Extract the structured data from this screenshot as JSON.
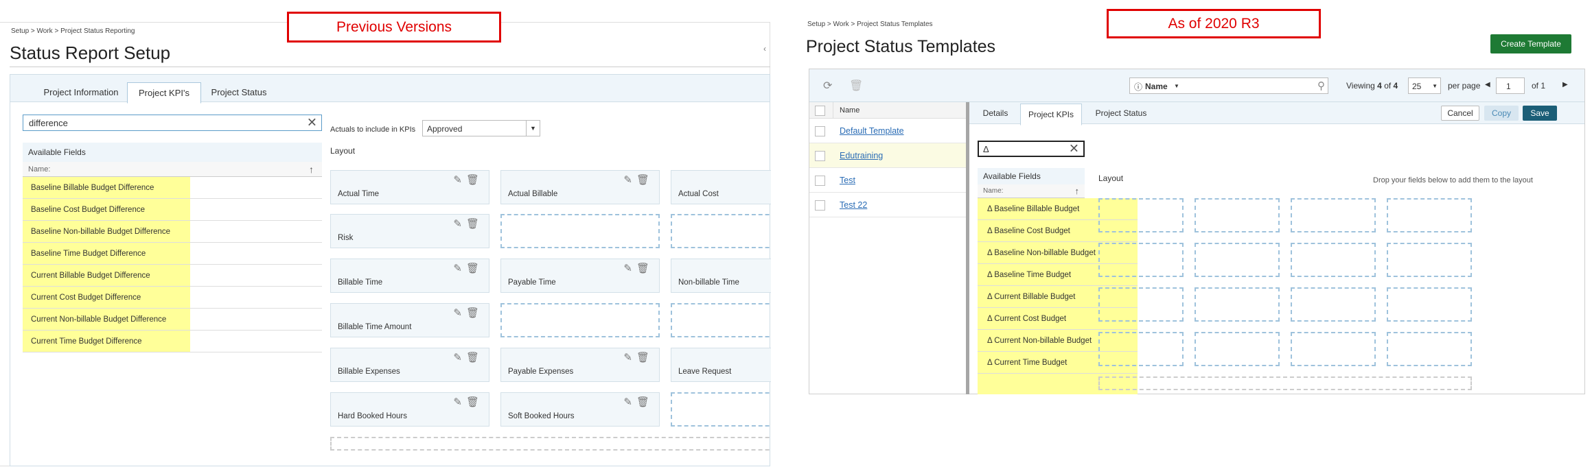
{
  "labels": {
    "previous": "Previous Versions",
    "current": "As of 2020 R3"
  },
  "left": {
    "breadcrumb": "Setup > Work > Project Status Reporting",
    "title": "Status Report Setup",
    "tabs": [
      "Project Information",
      "Project KPI's",
      "Project Status"
    ],
    "search_value": "difference",
    "available_fields_label": "Available Fields",
    "name_label": "Name:",
    "fields": [
      "Baseline Billable Budget Difference",
      "Baseline Cost Budget Difference",
      "Baseline Non-billable Budget Difference",
      "Baseline Time Budget Difference",
      "Current Billable Budget Difference",
      "Current Cost Budget Difference",
      "Current Non-billable Budget Difference",
      "Current Time Budget Difference"
    ],
    "actuals_label": "Actuals to include in KPIs",
    "actuals_value": "Approved",
    "layout_label": "Layout",
    "kpis": {
      "actual_time": "Actual Time",
      "actual_billable": "Actual Billable",
      "actual_cost": "Actual Cost",
      "risk": "Risk",
      "billable_time": "Billable Time",
      "payable_time": "Payable Time",
      "non_billable_time": "Non-billable Time",
      "billable_time_amount": "Billable Time Amount",
      "billable_expenses": "Billable Expenses",
      "payable_expenses": "Payable Expenses",
      "leave_request": "Leave Request",
      "hard_booked_hours": "Hard Booked Hours",
      "soft_booked_hours": "Soft Booked Hours"
    }
  },
  "right": {
    "breadcrumb": "Setup > Work > Project Status Templates",
    "title": "Project Status Templates",
    "create_button": "Create Template",
    "search_dropdown": "Name",
    "viewing_prefix": "Viewing",
    "viewing_count": "4",
    "viewing_of": "of",
    "viewing_total": "4",
    "per_page_value": "25",
    "per_page_label": "per page",
    "page_value": "1",
    "page_of": "of 1",
    "name_col": "Name",
    "templates": [
      "Default Template",
      "Edutraining",
      "Test",
      "Test 22"
    ],
    "tabs": [
      "Details",
      "Project KPIs",
      "Project Status"
    ],
    "cancel": "Cancel",
    "copy": "Copy",
    "save": "Save",
    "search_value": "Δ",
    "available_fields_label": "Available Fields",
    "name_label": "Name:",
    "fields": [
      "Δ Baseline Billable Budget",
      "Δ Baseline Cost Budget",
      "Δ Baseline Non-billable Budget",
      "Δ Baseline Time Budget",
      "Δ Current Billable Budget",
      "Δ Current Cost Budget",
      "Δ Current Non-billable Budget",
      "Δ Current Time Budget"
    ],
    "layout_label": "Layout",
    "drop_hint": "Drop your fields below to add them to the layout"
  },
  "colors": {
    "highlight": "#ffff99",
    "label_red": "#e00000",
    "save": "#1b5e77",
    "create": "#1e7a34"
  }
}
